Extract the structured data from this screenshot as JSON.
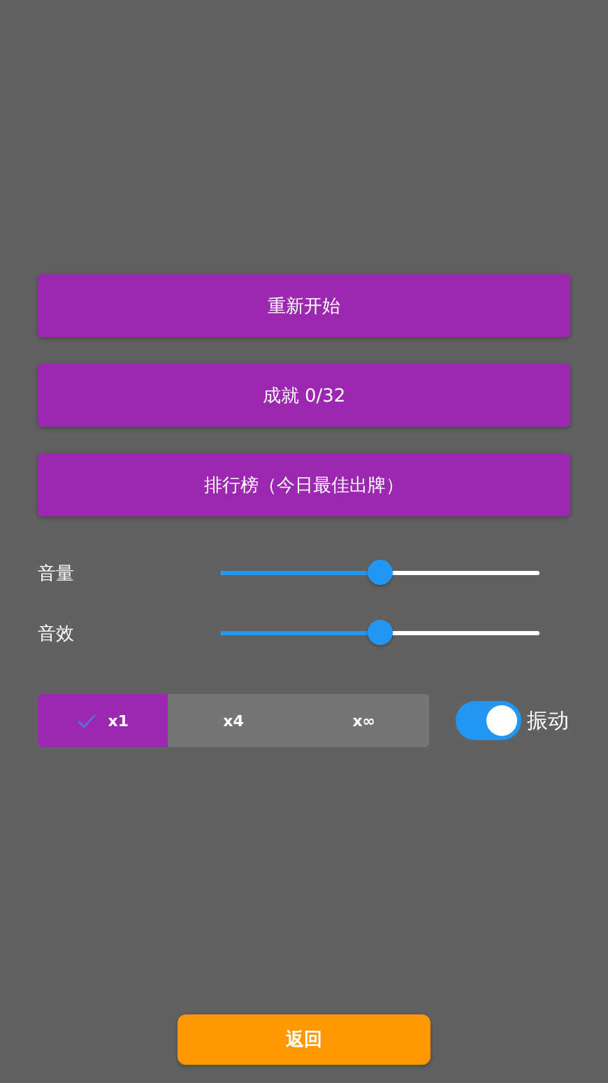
{
  "menu_buttons": [
    {
      "label": "重新开始"
    },
    {
      "label": "成就 0/32"
    },
    {
      "label": "排行榜（今日最佳出牌）"
    }
  ],
  "sliders": [
    {
      "label": "音量",
      "level": 0.5
    },
    {
      "label": "音效",
      "level": 0.5
    }
  ],
  "multiplier": [
    {
      "label": "x1",
      "selected": true
    },
    {
      "label": "x4",
      "selected": false
    },
    {
      "label": "x∞",
      "selected": false
    }
  ],
  "vibration": {
    "label": "振动",
    "on": true
  },
  "back_button": {
    "label": "返回"
  }
}
